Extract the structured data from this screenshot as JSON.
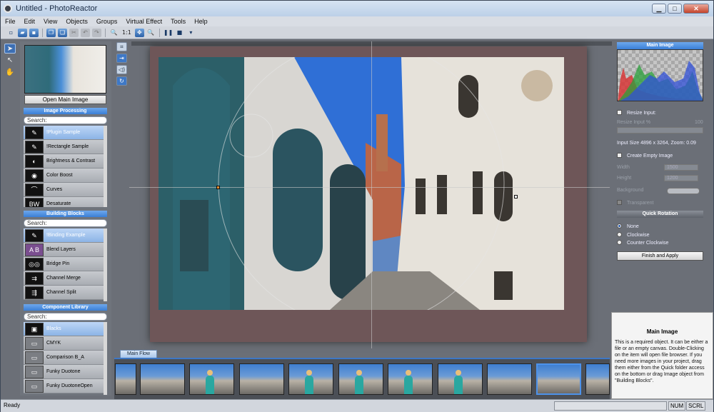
{
  "window": {
    "title": "Untitled - PhotoReactor",
    "minimize": "▁",
    "maximize": "□",
    "close": "✕"
  },
  "menu": [
    "File",
    "Edit",
    "View",
    "Objects",
    "Groups",
    "Virtual Effect",
    "Tools",
    "Help"
  ],
  "toolbar": {
    "zoom_label": "1:1"
  },
  "left_panel": {
    "open_button": "Open Main Image",
    "image_processing": {
      "title": "Image Processing",
      "search": "Search:",
      "items": [
        "!Plugin Sample",
        "!Rectangle Sample",
        "Brightness & Contrast",
        "Color Boost",
        "Curves",
        "Desaturate"
      ]
    },
    "building_blocks": {
      "title": "Building Blocks",
      "search": "Search:",
      "items": [
        "!Binding Example",
        "Blend Layers",
        "Bridge Pin",
        "Channel Merge",
        "Channel Split"
      ]
    },
    "component_library": {
      "title": "Component Library",
      "search": "Search:",
      "items": [
        "Blacks",
        "CMYK",
        "Comparison B_A",
        "Funky Duotone",
        "Funky DuotoneOpen"
      ]
    }
  },
  "flow": {
    "tab_label": "Main Flow",
    "thumbnail_count": 10,
    "selected_index": 8
  },
  "right_panel": {
    "header": "Main Image",
    "resize_input": "Resize Input:",
    "resize_input_pct_label": "Resize Input %",
    "resize_input_pct_value": "100",
    "input_size": "Input Size 4896 x 3264, Zoom: 0.09",
    "create_empty": "Create Empty Image",
    "width_label": "Width",
    "width_value": "1500",
    "height_label": "Height",
    "height_value": "1200",
    "background_label": "Background",
    "transparent_label": "Transparent",
    "quick_rotation": "Quick Rotation",
    "rotation_options": [
      "None",
      "Clockwise",
      "Counter Clockwise"
    ],
    "apply_button": "Finish and Apply"
  },
  "help": {
    "title": "Main Image",
    "text": "This is a required object. It can be either a file or an empty canvas. Double-Clicking on the item will open file browser. If you need more images in your project, drag them either from the Quick folder access on the bottom or drag Image object from \"Building Blocks\"."
  },
  "status": {
    "ready": "Ready",
    "num": "NUM",
    "scrl": "SCRL"
  }
}
